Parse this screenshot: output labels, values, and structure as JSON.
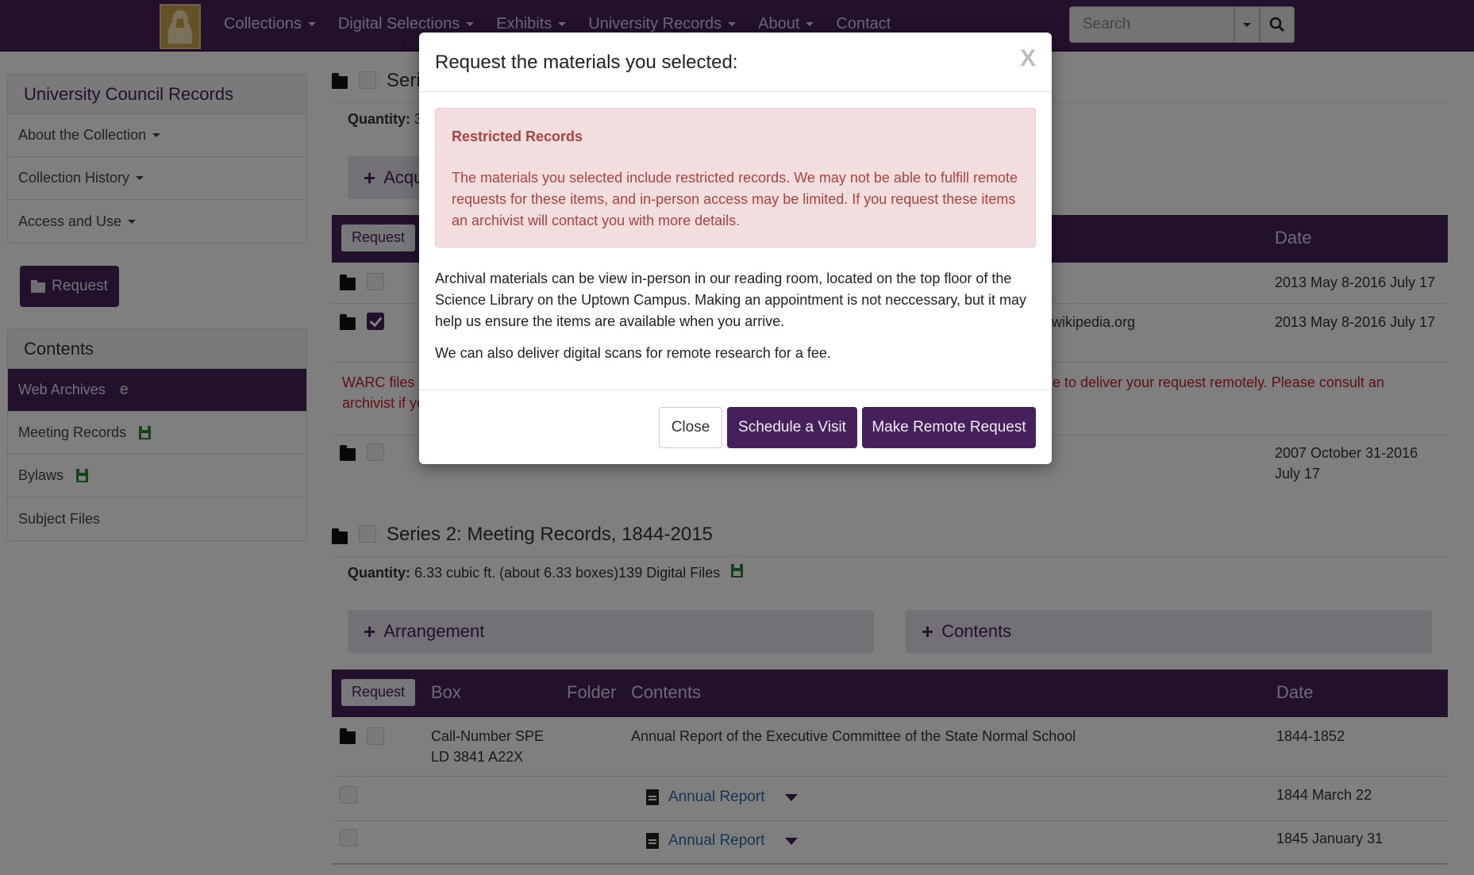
{
  "nav": {
    "items": [
      "Collections",
      "Digital Selections",
      "Exhibits",
      "University Records",
      "About",
      "Contact"
    ],
    "search_placeholder": "Search"
  },
  "sidebar": {
    "title": "University Council Records",
    "items": [
      "About the Collection",
      "Collection History",
      "Access and Use"
    ],
    "request_label": "Request",
    "contents_title": "Contents",
    "contents": [
      "Web Archives",
      "Meeting Records",
      "Bylaws",
      "Subject Files"
    ]
  },
  "series1": {
    "title_fragment": "Seri",
    "qty_label": "Quantity:",
    "qty_fragment": "3",
    "btn_fragment": "Acqu",
    "header": {
      "request": "Request",
      "date": "Date"
    },
    "rows": [
      {
        "date": "2013 May 8-2016 July 17"
      },
      {
        "contents_fragment": "n.wikipedia.org",
        "date": "2013 May 8-2016 July 17"
      },
      {
        "date_line1": "2007 October 31-2016",
        "date_line2": "July 17"
      }
    ],
    "warning_left_1": "WARC files",
    "warning_left_2": "archivist if yo",
    "warning_right": "le to deliver your request remotely. Please consult an"
  },
  "series2": {
    "title": "Series 2: Meeting Records, 1844-2015",
    "qty_label": "Quantity:",
    "qty_value": "6.33 cubic ft. (about 6.33 boxes)139 Digital Files",
    "arrangement_label": "Arrangement",
    "contents_label": "Contents",
    "header": {
      "request": "Request",
      "box": "Box",
      "folder": "Folder",
      "contents": "Contents",
      "date": "Date"
    },
    "rows": [
      {
        "box_line1": "Call-Number SPE",
        "box_line2": "LD 3841 A22X",
        "contents": "Annual Report of the Executive Committee of the State Normal School",
        "date": "1844-1852"
      },
      {
        "link": "Annual Report",
        "date": "1844 March 22"
      },
      {
        "link": "Annual Report",
        "date": "1845 January 31"
      }
    ]
  },
  "modal": {
    "title": "Request the materials you selected:",
    "close_x": "X",
    "alert_title": "Restricted Records",
    "alert_text": "The materials you selected include restricted records. We may not be able to fulfill remote requests for these items, and in-person access may be limited. If you request these items an archivist will contact you with more details.",
    "body_p1": "Archival materials can be view in-person in our reading room, located on the top floor of the Science Library on the Uptown Campus. Making an appointment is not neccessary, but it may help us ensure the items are available when you arrive.",
    "body_p2": "We can also deliver digital scans for remote research for a fee.",
    "btn_close": "Close",
    "btn_schedule": "Schedule a Visit",
    "btn_remote": "Make Remote Request"
  },
  "colors": {
    "brand": "#46205a",
    "alert_bg": "#f2dede",
    "alert_text": "#a94442",
    "link": "#2d6aa8",
    "warning": "#c0202a"
  }
}
